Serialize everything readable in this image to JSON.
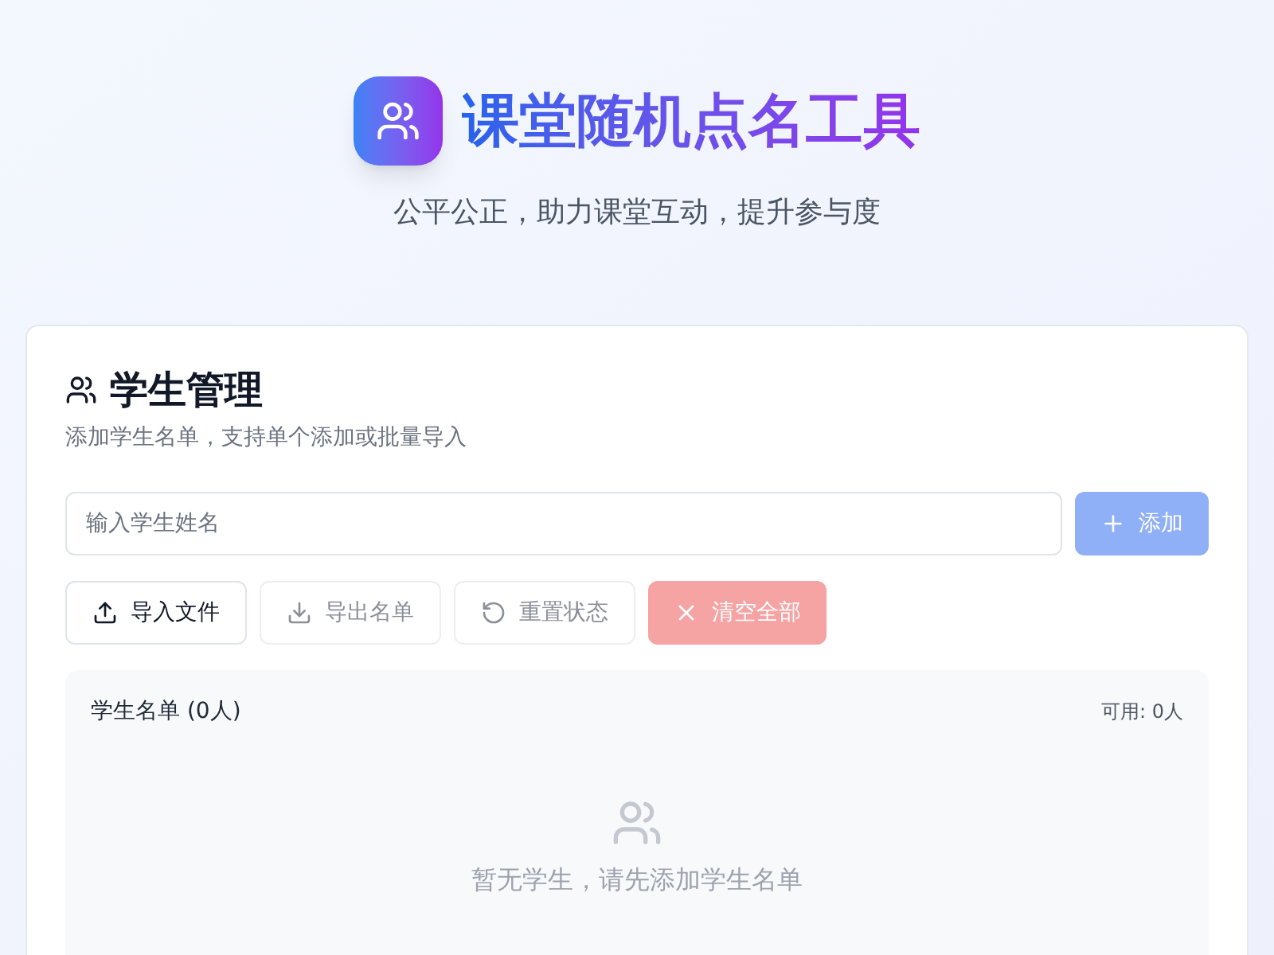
{
  "header": {
    "title": "课堂随机点名工具",
    "subtitle": "公平公正，助力课堂互动，提升参与度"
  },
  "student_panel": {
    "title": "学生管理",
    "description": "添加学生名单，支持单个添加或批量导入",
    "name_input": {
      "placeholder": "输入学生姓名"
    },
    "add_button": {
      "label": "添加",
      "disabled": true
    },
    "actions": [
      {
        "kind": "upload",
        "label": "导入文件",
        "disabled": false
      },
      {
        "kind": "download",
        "label": "导出名单",
        "disabled": true
      },
      {
        "kind": "reset",
        "label": "重置状态",
        "disabled": true
      },
      {
        "kind": "clear",
        "label": "清空全部",
        "disabled": true
      }
    ],
    "roster": {
      "title": "学生名单 (0人)",
      "available": "可用: 0人",
      "empty_message": "暂无学生，请先添加学生名单"
    }
  }
}
